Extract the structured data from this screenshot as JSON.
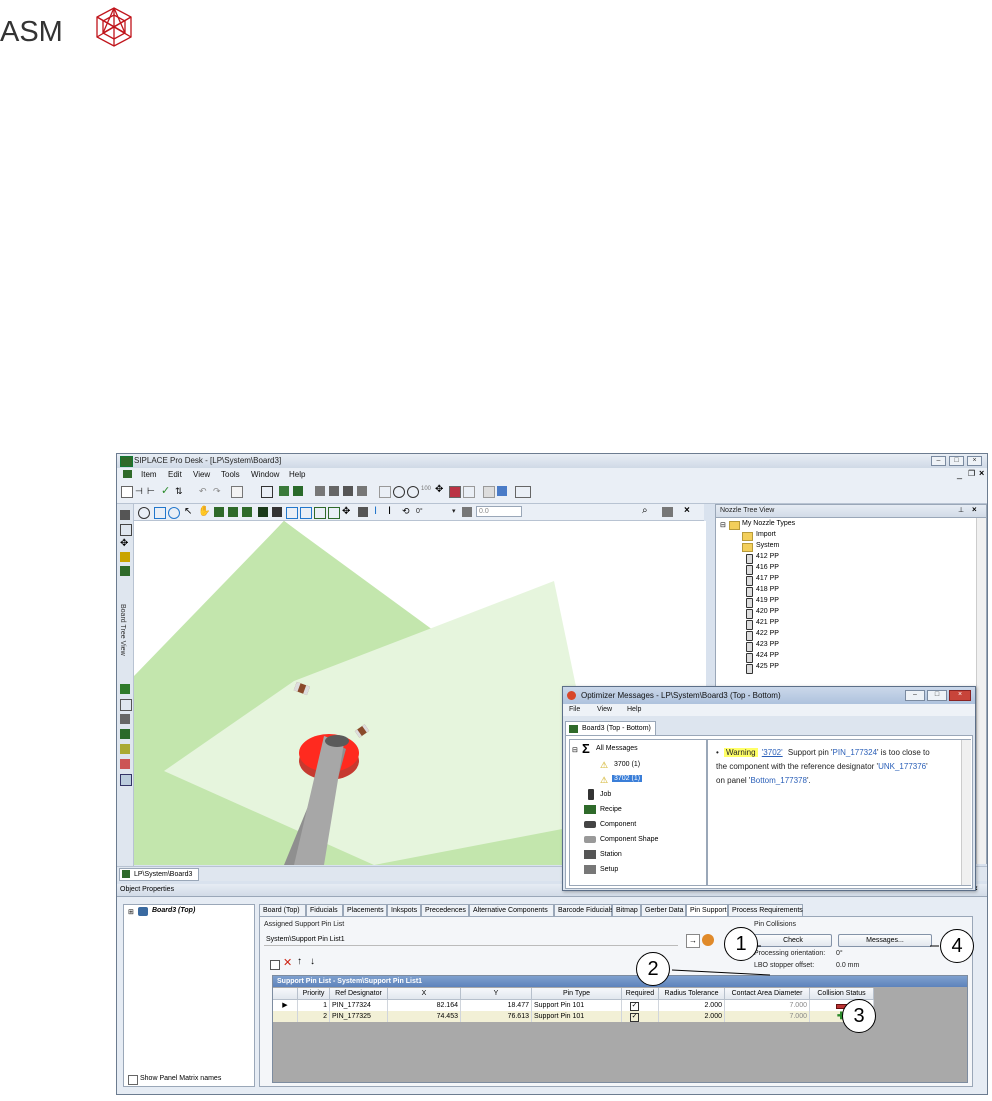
{
  "logo": {
    "text": "ASM"
  },
  "window": {
    "title": "SIPLACE Pro Desk - [LP\\System\\Board3]",
    "menu": [
      "Item",
      "Edit",
      "View",
      "Tools",
      "Window",
      "Help"
    ],
    "angle_value": "0°",
    "offset_value": "0.0"
  },
  "left_panel": {
    "label": "Board Tree View"
  },
  "nozzle_tree": {
    "title": "Nozzle Tree View",
    "root": "My Nozzle Types",
    "folders": [
      "Import",
      "System"
    ],
    "items": [
      "412 PP",
      "416 PP",
      "417 PP",
      "418 PP",
      "419 PP",
      "420 PP",
      "421 PP",
      "422 PP",
      "423 PP",
      "424 PP",
      "425 PP"
    ]
  },
  "doc_tab": "LP\\System\\Board3",
  "object_properties": {
    "title": "Object Properties",
    "tree_item": "Board3 (Top)",
    "show_panel_matrix": "Show Panel Matrix names",
    "tabs": [
      "Board (Top)",
      "Fiducials",
      "Placements",
      "Inkspots",
      "Precedences",
      "Alternative Components",
      "Barcode Fiducials",
      "Bitmap",
      "Gerber Data",
      "Pin Support",
      "Process Requirements"
    ],
    "active_tab": "Pin Support",
    "assigned_label": "Assigned Support Pin List",
    "assigned_value": "System\\Support Pin List1",
    "pin_collisions_label": "Pin Collisions",
    "check_label": "Check",
    "messages_label": "Messages...",
    "processing_orientation_label": "Processing orientation:",
    "processing_orientation_value": "0°",
    "lbo_label": "LBO stopper offset:",
    "lbo_value": "0.0 mm",
    "grid": {
      "title": "Support Pin List - System\\Support Pin List1",
      "columns": [
        "Priority",
        "Ref Designator",
        "X",
        "Y",
        "Pin Type",
        "Required",
        "Radius Tolerance",
        "Contact Area Diameter",
        "Collision Status"
      ],
      "rows": [
        {
          "priority": "1",
          "ref": "PIN_177324",
          "x": "82.164",
          "y": "18.477",
          "type": "Support Pin 101",
          "tol": "2.000",
          "dia": "7.000",
          "status": "collision"
        },
        {
          "priority": "2",
          "ref": "PIN_177325",
          "x": "74.453",
          "y": "76.613",
          "type": "Support Pin 101",
          "tol": "2.000",
          "dia": "7.000",
          "status": "ok"
        }
      ]
    }
  },
  "optimizer": {
    "title": "Optimizer Messages - LP\\System\\Board3 (Top - Bottom)",
    "menu": [
      "File",
      "View",
      "Help"
    ],
    "tab": "Board3 (Top - Bottom)",
    "tree": {
      "all": "All Messages",
      "codes": [
        "3700 (1)",
        "3702 (1)"
      ],
      "categories": [
        "Job",
        "Recipe",
        "Component",
        "Component Shape",
        "Station",
        "Setup"
      ]
    },
    "message": {
      "level": "Warning",
      "code": "'3702'",
      "t1": "Support pin '",
      "pin": "PIN_177324",
      "t2": "' is too close to",
      "line2": "the component with the reference designator '",
      "ref": "UNK_177376",
      "q": "'",
      "line3": "on panel '",
      "panel": "Bottom_177378",
      "end": "'."
    }
  },
  "callouts": [
    "1",
    "2",
    "3",
    "4"
  ],
  "colors": {
    "accent": "#5d83bb",
    "board": "#c3e6ad",
    "warning": "#ffff66",
    "link": "#2a5fb8"
  }
}
